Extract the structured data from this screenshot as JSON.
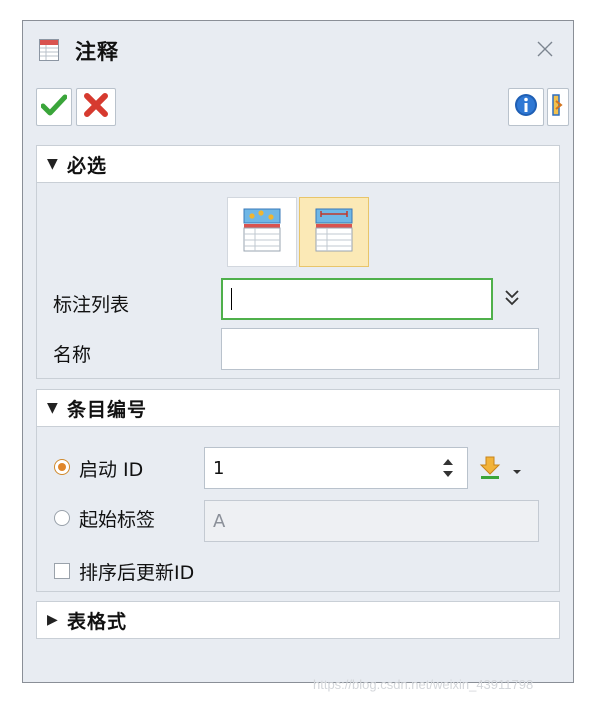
{
  "dialog": {
    "title": "注释",
    "ok_icon": "checkmark-icon",
    "cancel_icon": "x-icon",
    "info_icon": "info-icon",
    "collapse_icon": "chevron-right-icon",
    "close_icon": "close-icon"
  },
  "sections": {
    "required": {
      "label": "必选",
      "expanded": true,
      "tiles": [
        {
          "name": "balloon-table-icon",
          "selected": false
        },
        {
          "name": "dimension-table-icon",
          "selected": true
        }
      ],
      "annotation_list_label": "标注列表",
      "annotation_list_value": "",
      "name_label": "名称",
      "name_value": ""
    },
    "item_number": {
      "label": "条目编号",
      "expanded": true,
      "start_id_label": "启动 ID",
      "start_id_value": "1",
      "start_id_selected": true,
      "start_label_label": "起始标签",
      "start_label_value": "A",
      "start_label_selected": false,
      "sort_update_label": "排序后更新ID",
      "sort_update_checked": false
    },
    "table_format": {
      "label": "表格式",
      "expanded": false
    }
  },
  "watermark": "https://blog.csdn.net/weixin_43911798",
  "colors": {
    "accent_green": "#4fb04b",
    "radio_orange": "#e0862a",
    "tile_selected": "#fbe9b6"
  }
}
